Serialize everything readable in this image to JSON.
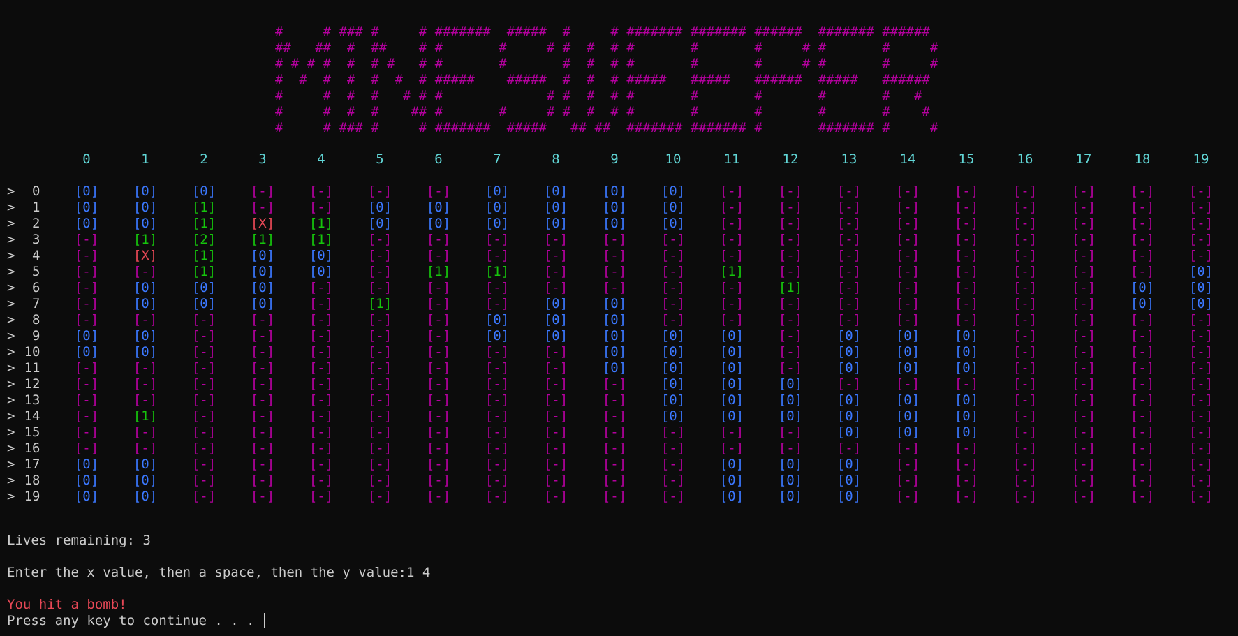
{
  "banner": {
    "lines": [
      "#     # ### #     # #######  #####  #     # ####### ####### ######  ####### ######",
      "##   ##  #  ##    # #       #     # #  #  # #       #       #     # #       #     #",
      "# # # #  #  # #   # #       #       #  #  # #       #       #     # #       #     #",
      "#  #  #  #  #  #  # #####    #####  #  #  # #####   #####   ######  #####   ######",
      "#     #  #  #   # # #             # #  #  # #       #       #       #       #   #",
      "#     #  #  #    ## #       #     # #  #  # #       #       #       #       #    #",
      "#     # ### #     # #######  #####   ## ##  ####### ####### #       ####### #     #"
    ]
  },
  "grid": {
    "columns": [
      "0",
      "1",
      "2",
      "3",
      "4",
      "5",
      "6",
      "7",
      "8",
      "9",
      "10",
      "11",
      "12",
      "13",
      "14",
      "15",
      "16",
      "17",
      "18",
      "19"
    ],
    "row_prefix": ">",
    "rows": [
      {
        "label": "0",
        "cells": [
          "[0]",
          "[0]",
          "[0]",
          "[-]",
          "[-]",
          "[-]",
          "[-]",
          "[0]",
          "[0]",
          "[0]",
          "[0]",
          "[-]",
          "[-]",
          "[-]",
          "[-]",
          "[-]",
          "[-]",
          "[-]",
          "[-]",
          "[-]"
        ]
      },
      {
        "label": "1",
        "cells": [
          "[0]",
          "[0]",
          "[1]",
          "[-]",
          "[-]",
          "[0]",
          "[0]",
          "[0]",
          "[0]",
          "[0]",
          "[0]",
          "[-]",
          "[-]",
          "[-]",
          "[-]",
          "[-]",
          "[-]",
          "[-]",
          "[-]",
          "[-]"
        ]
      },
      {
        "label": "2",
        "cells": [
          "[0]",
          "[0]",
          "[1]",
          "[X]",
          "[1]",
          "[0]",
          "[0]",
          "[0]",
          "[0]",
          "[0]",
          "[0]",
          "[-]",
          "[-]",
          "[-]",
          "[-]",
          "[-]",
          "[-]",
          "[-]",
          "[-]",
          "[-]"
        ]
      },
      {
        "label": "3",
        "cells": [
          "[-]",
          "[1]",
          "[2]",
          "[1]",
          "[1]",
          "[-]",
          "[-]",
          "[-]",
          "[-]",
          "[-]",
          "[-]",
          "[-]",
          "[-]",
          "[-]",
          "[-]",
          "[-]",
          "[-]",
          "[-]",
          "[-]",
          "[-]"
        ]
      },
      {
        "label": "4",
        "cells": [
          "[-]",
          "[X]",
          "[1]",
          "[0]",
          "[0]",
          "[-]",
          "[-]",
          "[-]",
          "[-]",
          "[-]",
          "[-]",
          "[-]",
          "[-]",
          "[-]",
          "[-]",
          "[-]",
          "[-]",
          "[-]",
          "[-]",
          "[-]"
        ]
      },
      {
        "label": "5",
        "cells": [
          "[-]",
          "[-]",
          "[1]",
          "[0]",
          "[0]",
          "[-]",
          "[1]",
          "[1]",
          "[-]",
          "[-]",
          "[-]",
          "[1]",
          "[-]",
          "[-]",
          "[-]",
          "[-]",
          "[-]",
          "[-]",
          "[-]",
          "[0]"
        ]
      },
      {
        "label": "6",
        "cells": [
          "[-]",
          "[0]",
          "[0]",
          "[0]",
          "[-]",
          "[-]",
          "[-]",
          "[-]",
          "[-]",
          "[-]",
          "[-]",
          "[-]",
          "[1]",
          "[-]",
          "[-]",
          "[-]",
          "[-]",
          "[-]",
          "[0]",
          "[0]"
        ]
      },
      {
        "label": "7",
        "cells": [
          "[-]",
          "[0]",
          "[0]",
          "[0]",
          "[-]",
          "[1]",
          "[-]",
          "[-]",
          "[0]",
          "[0]",
          "[-]",
          "[-]",
          "[-]",
          "[-]",
          "[-]",
          "[-]",
          "[-]",
          "[-]",
          "[0]",
          "[0]"
        ]
      },
      {
        "label": "8",
        "cells": [
          "[-]",
          "[-]",
          "[-]",
          "[-]",
          "[-]",
          "[-]",
          "[-]",
          "[0]",
          "[0]",
          "[0]",
          "[-]",
          "[-]",
          "[-]",
          "[-]",
          "[-]",
          "[-]",
          "[-]",
          "[-]",
          "[-]",
          "[-]"
        ]
      },
      {
        "label": "9",
        "cells": [
          "[0]",
          "[0]",
          "[-]",
          "[-]",
          "[-]",
          "[-]",
          "[-]",
          "[0]",
          "[0]",
          "[0]",
          "[0]",
          "[0]",
          "[-]",
          "[0]",
          "[0]",
          "[0]",
          "[-]",
          "[-]",
          "[-]",
          "[-]"
        ]
      },
      {
        "label": "10",
        "cells": [
          "[0]",
          "[0]",
          "[-]",
          "[-]",
          "[-]",
          "[-]",
          "[-]",
          "[-]",
          "[-]",
          "[0]",
          "[0]",
          "[0]",
          "[-]",
          "[0]",
          "[0]",
          "[0]",
          "[-]",
          "[-]",
          "[-]",
          "[-]"
        ]
      },
      {
        "label": "11",
        "cells": [
          "[-]",
          "[-]",
          "[-]",
          "[-]",
          "[-]",
          "[-]",
          "[-]",
          "[-]",
          "[-]",
          "[0]",
          "[0]",
          "[0]",
          "[-]",
          "[0]",
          "[0]",
          "[0]",
          "[-]",
          "[-]",
          "[-]",
          "[-]"
        ]
      },
      {
        "label": "12",
        "cells": [
          "[-]",
          "[-]",
          "[-]",
          "[-]",
          "[-]",
          "[-]",
          "[-]",
          "[-]",
          "[-]",
          "[-]",
          "[0]",
          "[0]",
          "[0]",
          "[-]",
          "[-]",
          "[-]",
          "[-]",
          "[-]",
          "[-]",
          "[-]"
        ]
      },
      {
        "label": "13",
        "cells": [
          "[-]",
          "[-]",
          "[-]",
          "[-]",
          "[-]",
          "[-]",
          "[-]",
          "[-]",
          "[-]",
          "[-]",
          "[0]",
          "[0]",
          "[0]",
          "[0]",
          "[0]",
          "[0]",
          "[-]",
          "[-]",
          "[-]",
          "[-]"
        ]
      },
      {
        "label": "14",
        "cells": [
          "[-]",
          "[1]",
          "[-]",
          "[-]",
          "[-]",
          "[-]",
          "[-]",
          "[-]",
          "[-]",
          "[-]",
          "[0]",
          "[0]",
          "[0]",
          "[0]",
          "[0]",
          "[0]",
          "[-]",
          "[-]",
          "[-]",
          "[-]"
        ]
      },
      {
        "label": "15",
        "cells": [
          "[-]",
          "[-]",
          "[-]",
          "[-]",
          "[-]",
          "[-]",
          "[-]",
          "[-]",
          "[-]",
          "[-]",
          "[-]",
          "[-]",
          "[-]",
          "[0]",
          "[0]",
          "[0]",
          "[-]",
          "[-]",
          "[-]",
          "[-]"
        ]
      },
      {
        "label": "16",
        "cells": [
          "[-]",
          "[-]",
          "[-]",
          "[-]",
          "[-]",
          "[-]",
          "[-]",
          "[-]",
          "[-]",
          "[-]",
          "[-]",
          "[-]",
          "[-]",
          "[-]",
          "[-]",
          "[-]",
          "[-]",
          "[-]",
          "[-]",
          "[-]"
        ]
      },
      {
        "label": "17",
        "cells": [
          "[0]",
          "[0]",
          "[-]",
          "[-]",
          "[-]",
          "[-]",
          "[-]",
          "[-]",
          "[-]",
          "[-]",
          "[-]",
          "[0]",
          "[0]",
          "[0]",
          "[-]",
          "[-]",
          "[-]",
          "[-]",
          "[-]",
          "[-]"
        ]
      },
      {
        "label": "18",
        "cells": [
          "[0]",
          "[0]",
          "[-]",
          "[-]",
          "[-]",
          "[-]",
          "[-]",
          "[-]",
          "[-]",
          "[-]",
          "[-]",
          "[0]",
          "[0]",
          "[0]",
          "[-]",
          "[-]",
          "[-]",
          "[-]",
          "[-]",
          "[-]"
        ]
      },
      {
        "label": "19",
        "cells": [
          "[0]",
          "[0]",
          "[-]",
          "[-]",
          "[-]",
          "[-]",
          "[-]",
          "[-]",
          "[-]",
          "[-]",
          "[-]",
          "[0]",
          "[0]",
          "[0]",
          "[-]",
          "[-]",
          "[-]",
          "[-]",
          "[-]",
          "[-]"
        ]
      }
    ]
  },
  "colors": {
    "background": "#0c0c0c",
    "banner": "#b4009e",
    "column_header": "#61d6d6",
    "hidden_cell": "#b4009e",
    "zero_cell": "#3b78ff",
    "number_cell": "#16c60c",
    "bomb_cell": "#e74856",
    "text": "#cccccc",
    "error": "#e74856"
  },
  "status": {
    "lives": "Lives remaining: 3",
    "prompt": "Enter the x value, then a space, then the y value:",
    "input": "1 4",
    "message": "You hit a bomb!",
    "continue": "Press any key to continue . . . "
  }
}
